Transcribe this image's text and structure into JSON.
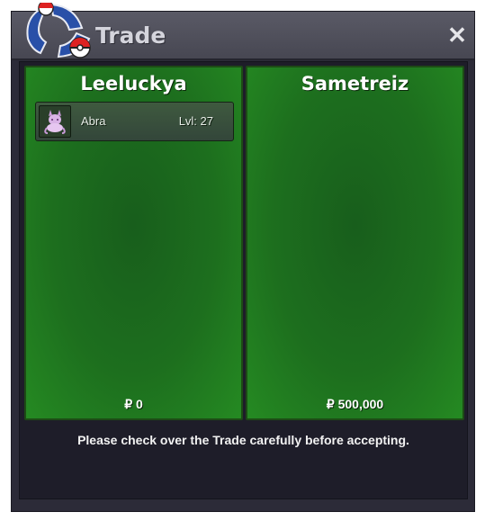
{
  "window": {
    "title": "Trade",
    "close_symbol": "✕"
  },
  "icons": {
    "logo": "pokeball-logo-icon",
    "close": "close-icon",
    "pokemon_sprite": "abra-sprite-icon"
  },
  "left_panel": {
    "trainer": "Leeluckya",
    "pokemon": [
      {
        "name": "Abra",
        "level": "Lvl: 27"
      }
    ],
    "money": "₽ 0"
  },
  "right_panel": {
    "trainer": "Sametreiz",
    "pokemon": [],
    "money": "₽ 500,000"
  },
  "notice": "Please check over the Trade carefully before accepting.",
  "colors": {
    "panel_green": "#1d6f1e",
    "window_bg": "#2c2b38",
    "title_bar": "#4f4f5a"
  }
}
